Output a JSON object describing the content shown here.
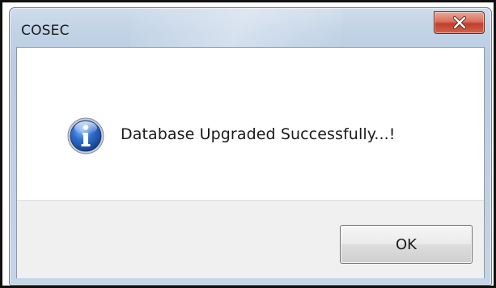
{
  "window": {
    "title": "COSEC"
  },
  "title_bar": {
    "close_icon": "close-x-icon",
    "close_color": "#c8412c"
  },
  "message": {
    "icon": "information-icon",
    "icon_color": "#2a64b8",
    "text": "Database Upgraded Successfully...!"
  },
  "buttons": {
    "ok_label": "OK"
  }
}
